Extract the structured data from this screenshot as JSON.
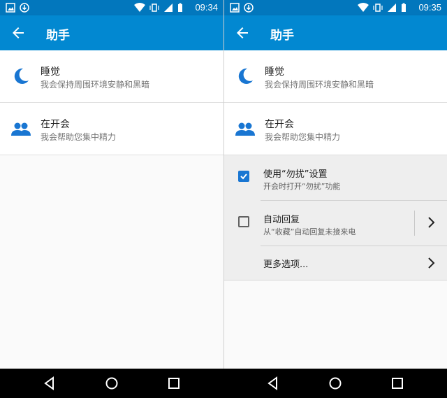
{
  "left": {
    "status": {
      "time": "09:34"
    },
    "header": {
      "title": "助手"
    },
    "items": [
      {
        "title": "睡觉",
        "subtitle": "我会保持周围环境安静和黑暗",
        "icon": "moon-icon"
      },
      {
        "title": "在开会",
        "subtitle": "我会帮助您集中精力",
        "icon": "people-icon"
      }
    ]
  },
  "right": {
    "status": {
      "time": "09:35"
    },
    "header": {
      "title": "助手"
    },
    "items": [
      {
        "title": "睡觉",
        "subtitle": "我会保持周围环境安静和黑暗",
        "icon": "moon-icon"
      },
      {
        "title": "在开会",
        "subtitle": "我会帮助您集中精力",
        "icon": "people-icon"
      }
    ],
    "options": [
      {
        "title": "使用“勿扰”设置",
        "subtitle": "开会时打开“勿扰”功能",
        "checked": true
      },
      {
        "title": "自动回复",
        "subtitle": "从“收藏”自动回复未接来电",
        "checked": false
      },
      {
        "title": "更多选项..."
      }
    ]
  },
  "colors": {
    "statusbar": "#0277bd",
    "appbar": "#0288d1",
    "accent": "#1976d2",
    "navbar": "#000000"
  }
}
